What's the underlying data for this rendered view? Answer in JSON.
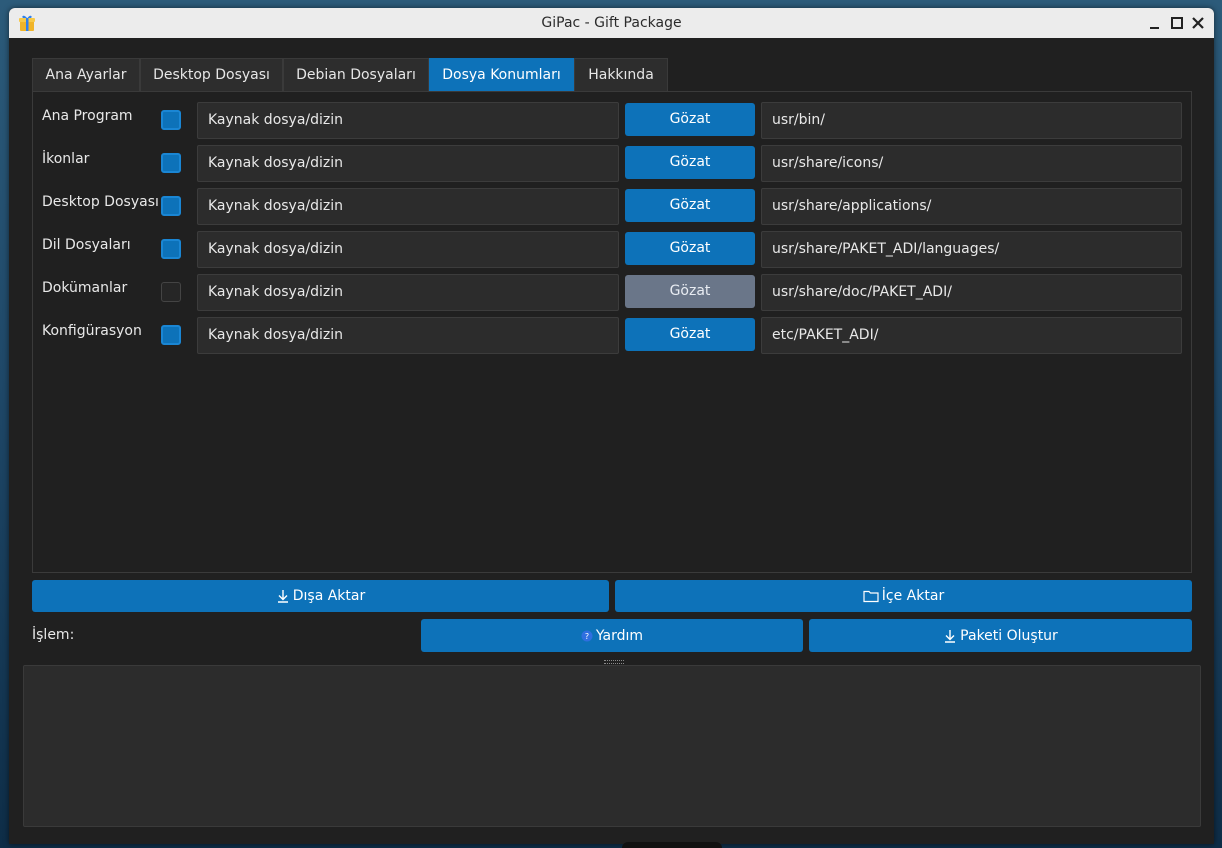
{
  "window": {
    "title": "GiPac - Gift Package"
  },
  "tabs": [
    {
      "label": "Ana Ayarlar",
      "active": false
    },
    {
      "label": "Desktop Dosyası",
      "active": false
    },
    {
      "label": "Debian Dosyaları",
      "active": false
    },
    {
      "label": "Dosya Konumları",
      "active": true
    },
    {
      "label": "Hakkında",
      "active": false
    }
  ],
  "rows": [
    {
      "label": "Ana Program",
      "checked": true,
      "source_placeholder": "Kaynak dosya/dizin",
      "browse_label": "Gözat",
      "browse_enabled": true,
      "destination": "usr/bin/"
    },
    {
      "label": "İkonlar",
      "checked": true,
      "source_placeholder": "Kaynak dosya/dizin",
      "browse_label": "Gözat",
      "browse_enabled": true,
      "destination": "usr/share/icons/"
    },
    {
      "label": "Desktop Dosyası",
      "checked": true,
      "source_placeholder": "Kaynak dosya/dizin",
      "browse_label": "Gözat",
      "browse_enabled": true,
      "destination": "usr/share/applications/"
    },
    {
      "label": "Dil Dosyaları",
      "checked": true,
      "source_placeholder": "Kaynak dosya/dizin",
      "browse_label": "Gözat",
      "browse_enabled": true,
      "destination": "usr/share/PAKET_ADI/languages/"
    },
    {
      "label": "Dokümanlar",
      "checked": false,
      "source_placeholder": "Kaynak dosya/dizin",
      "browse_label": "Gözat",
      "browse_enabled": false,
      "destination": "usr/share/doc/PAKET_ADI/"
    },
    {
      "label": "Konfigürasyon",
      "checked": true,
      "source_placeholder": "Kaynak dosya/dizin",
      "browse_label": "Gözat",
      "browse_enabled": true,
      "destination": "etc/PAKET_ADI/"
    }
  ],
  "actions": {
    "export_label": "Dışa Aktar",
    "import_label": "İçe Aktar",
    "status_label": "İşlem:",
    "help_label": "Yardım",
    "build_label": "Paketi Oluştur"
  },
  "icons": {
    "export": "download-arrow-icon",
    "import": "folder-icon",
    "help": "help-icon",
    "build": "download-arrow-icon"
  },
  "colors": {
    "accent": "#0d72b9",
    "disabled_button": "#6a7689",
    "background": "#202020",
    "field": "#2c2c2c"
  }
}
